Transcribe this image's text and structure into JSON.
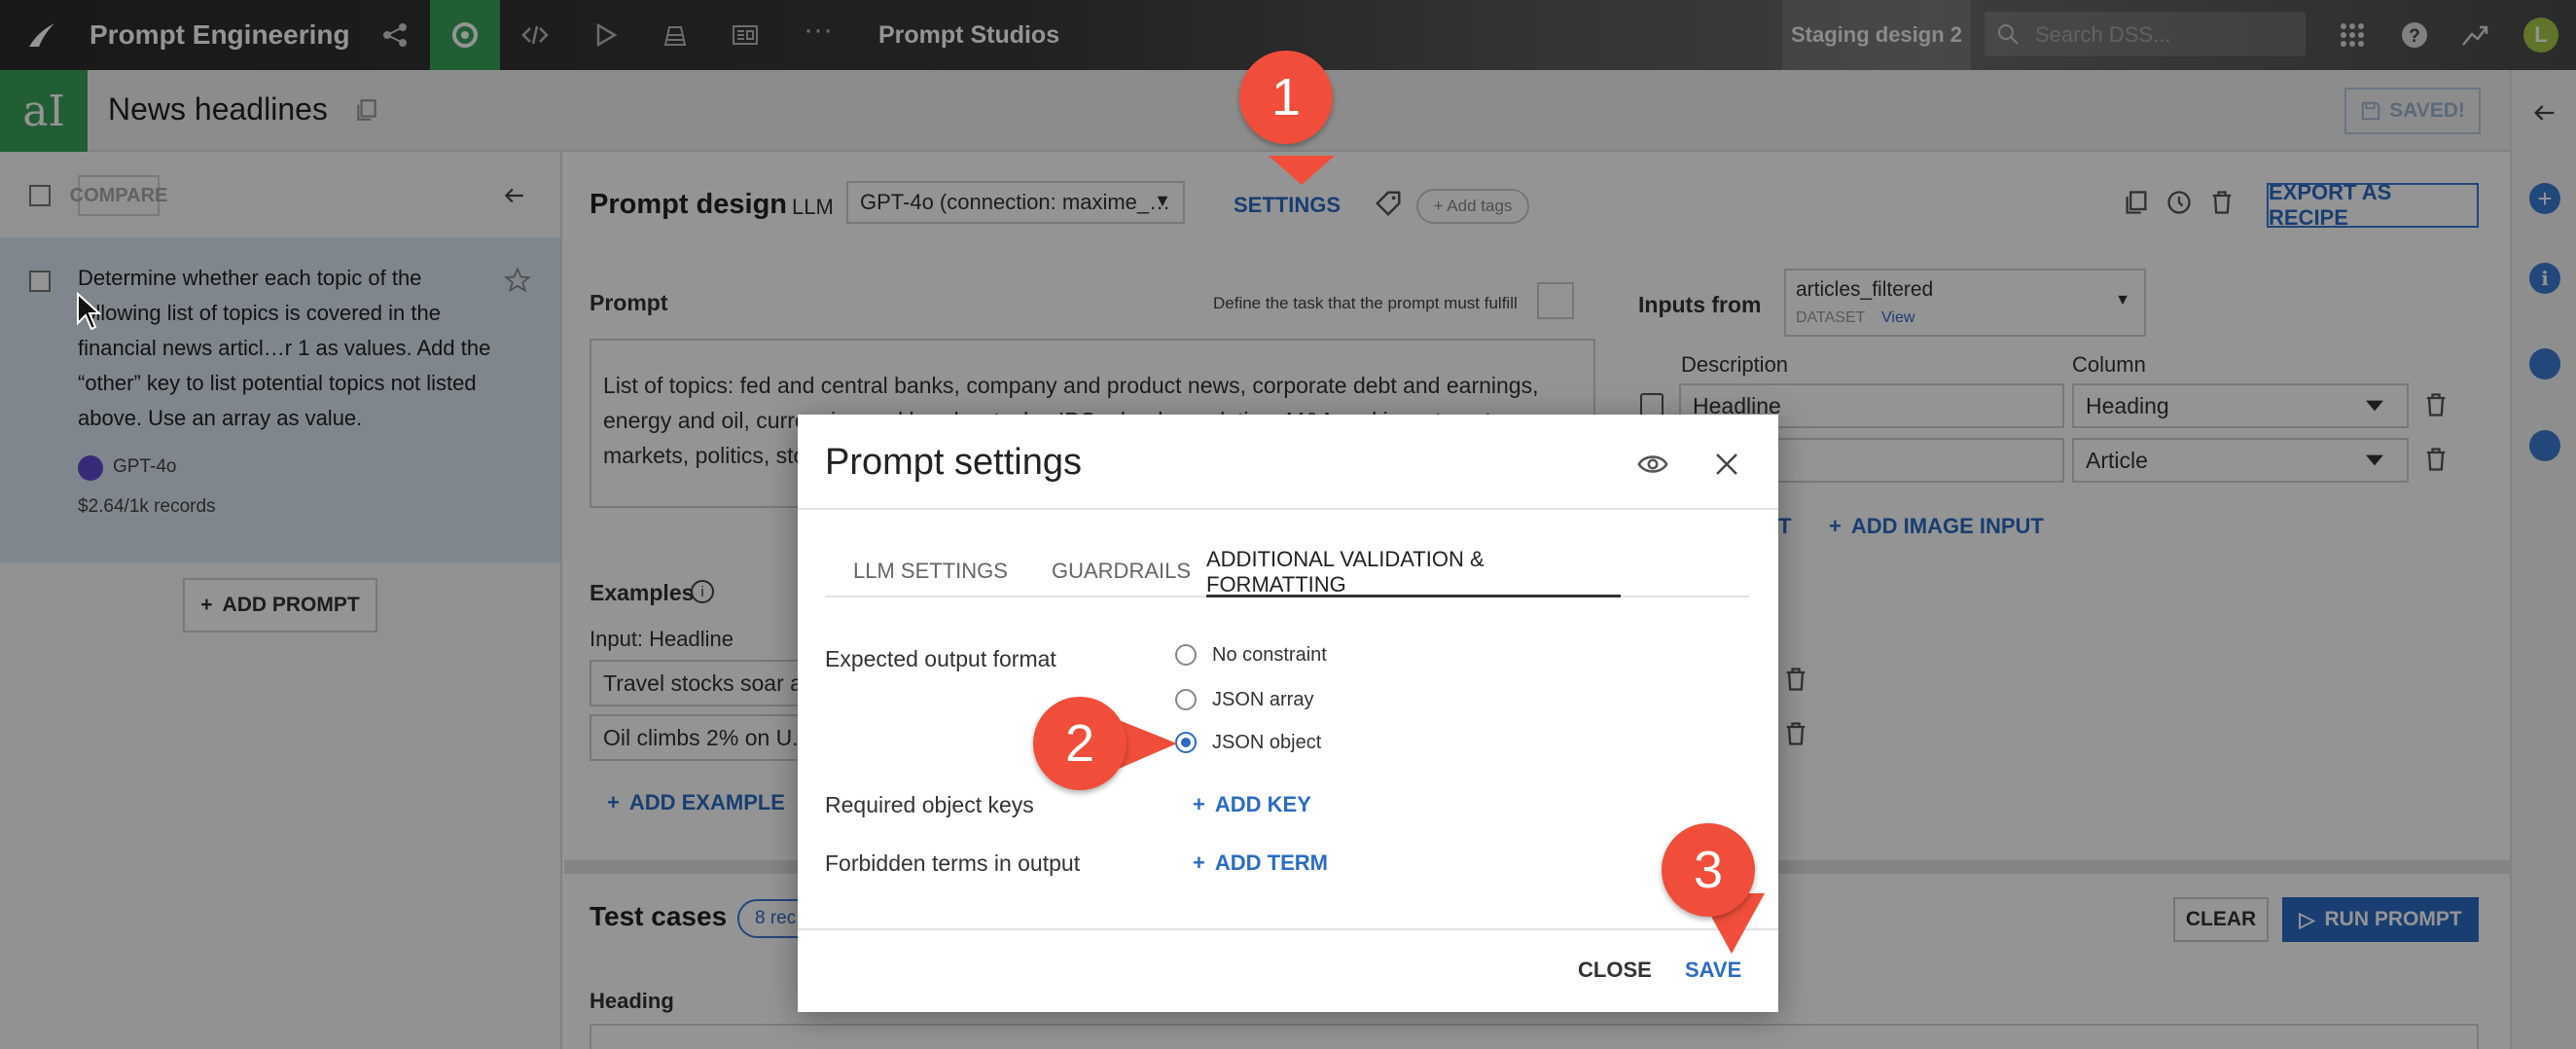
{
  "topnav": {
    "project_title": "Prompt Engineering",
    "section": "Prompt Studios",
    "instance": "Staging design 2",
    "search_placeholder": "Search DSS...",
    "user_initial": "L"
  },
  "objectbar": {
    "title": "News headlines",
    "saved_label": "SAVED!"
  },
  "leftpanel": {
    "compare_label": "COMPARE",
    "prompt_text": "Determine whether each topic of the following list of topics is covered in the financial news articl…r 1 as values. Add the “other” key to list potential topics not listed above. Use an array as value.",
    "prompt_model": "GPT-4o",
    "prompt_cost": "$2.64/1k records",
    "add_prompt_label": "ADD PROMPT"
  },
  "main": {
    "heading": "Prompt design",
    "llm_label": "LLM",
    "llm_value": "GPT-4o (connection: maxime_…",
    "settings_label": "SETTINGS",
    "add_tags_label": "+ Add tags",
    "export_label": "EXPORT AS RECIPE",
    "prompt_label": "Prompt",
    "prompt_hint": "Define the task that the prompt must fulfill",
    "prompt_body_l1": "List of topics: fed and central banks, company and product news, corporate debt and earnings,",
    "prompt_body_l2": "energy and oil, currencies and bonds, stocks, IPOs, bank regulation, M&A and investments,",
    "prompt_body_l3": "markets, politics, stocks",
    "inputs_from_label": "Inputs from",
    "dataset_name": "articles_filtered",
    "dataset_type": "DATASET",
    "dataset_view": "View",
    "desc_header": "Description",
    "column_header": "Column",
    "input_rows": [
      {
        "desc": "Headline",
        "col": "Heading"
      },
      {
        "desc": "",
        "col": "Article"
      }
    ],
    "add_text_input_label": "T",
    "add_image_input_label": "ADD IMAGE INPUT",
    "examples_label": "Examples",
    "examples_input_header": "Input: Headline",
    "example_rows": [
      "Travel stocks soar a",
      "Oil climbs 2% on U."
    ],
    "add_example_label": "ADD EXAMPLE",
    "test_cases_label": "Test cases",
    "test_cases_count": "8 rec",
    "clear_label": "CLEAR",
    "run_label": "RUN PROMPT",
    "heading_col": "Heading"
  },
  "modal": {
    "title": "Prompt settings",
    "tabs": [
      "LLM SETTINGS",
      "GUARDRAILS",
      "ADDITIONAL VALIDATION & FORMATTING"
    ],
    "active_tab": 2,
    "expected_format_label": "Expected output format",
    "options": [
      "No constraint",
      "JSON array",
      "JSON object"
    ],
    "selected_option": 2,
    "required_keys_label": "Required object keys",
    "add_key_label": "ADD KEY",
    "forbidden_terms_label": "Forbidden terms in output",
    "add_term_label": "ADD TERM",
    "close_label": "CLOSE",
    "save_label": "SAVE"
  },
  "callouts": [
    "1",
    "2",
    "3"
  ],
  "colors": {
    "accent": "#2b6cc4",
    "callout": "#f04e3a",
    "brand_green": "#3aa35a",
    "selected_prompt": "#dbe7f3"
  }
}
